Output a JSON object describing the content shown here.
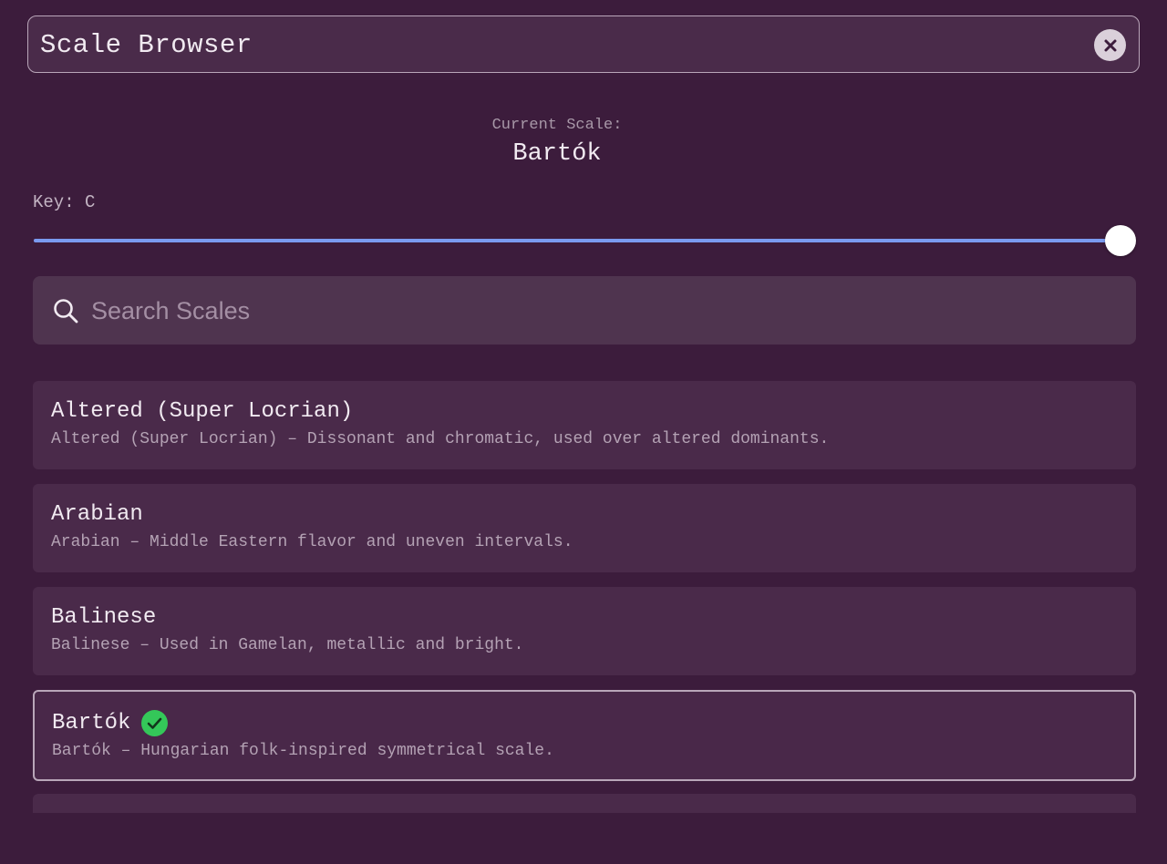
{
  "header": {
    "title": "Scale Browser",
    "close_icon": "close-icon"
  },
  "current_scale": {
    "label": "Current Scale:",
    "value": "Bartók"
  },
  "key": {
    "label": "Key: C",
    "slider_level": 1.0
  },
  "search": {
    "placeholder": "Search Scales",
    "value": "",
    "icon": "search-icon"
  },
  "scales": [
    {
      "name": "Altered (Super Locrian)",
      "description": "Altered (Super Locrian) – Dissonant and chromatic, used over altered dominants.",
      "selected": false
    },
    {
      "name": "Arabian",
      "description": "Arabian – Middle Eastern flavor and uneven intervals.",
      "selected": false
    },
    {
      "name": "Balinese",
      "description": "Balinese – Used in Gamelan, metallic and bright.",
      "selected": false
    },
    {
      "name": "Bartók",
      "description": "Bartók – Hungarian folk-inspired symmetrical scale.",
      "selected": true
    }
  ],
  "colors": {
    "background": "#3c1c3c",
    "accent": "#7a9af0",
    "selected_check": "#34c759"
  }
}
